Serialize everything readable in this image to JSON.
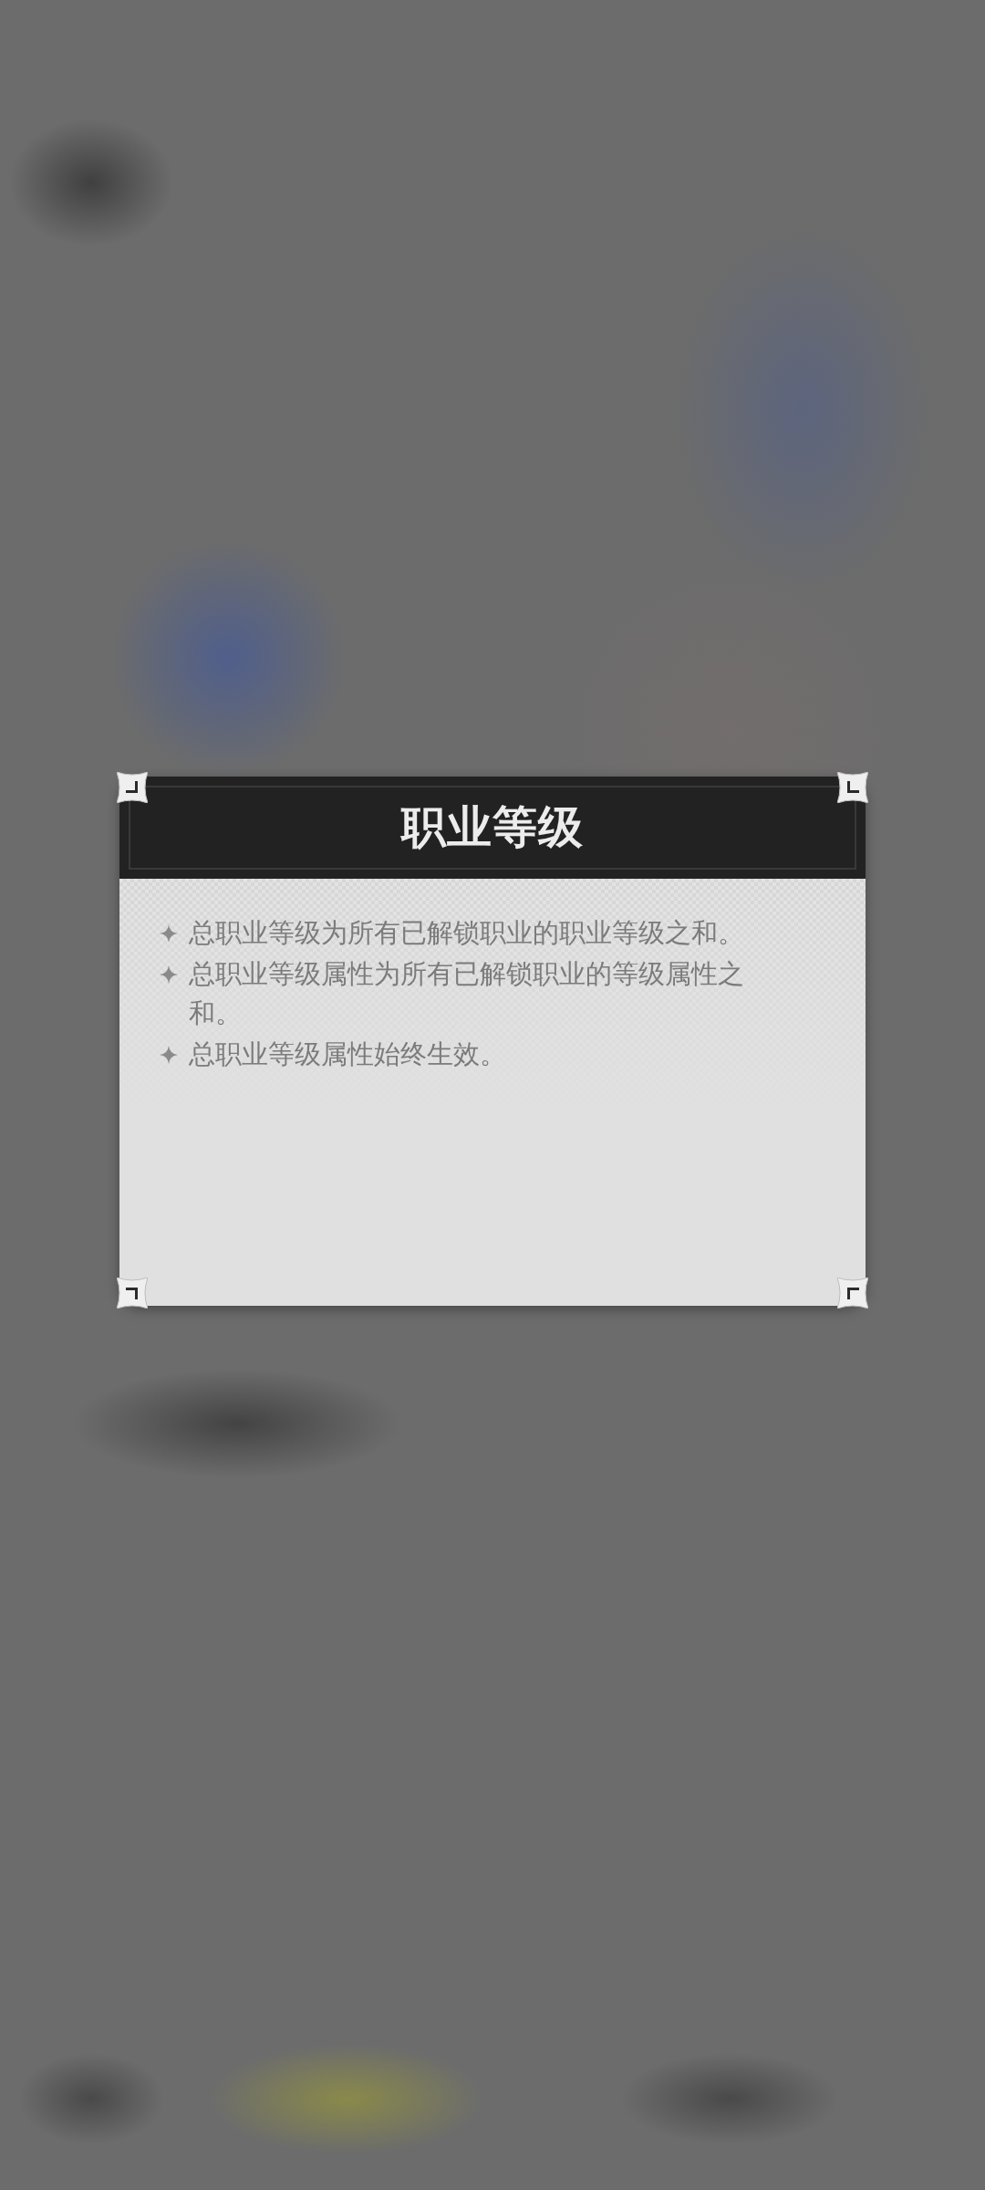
{
  "dialog": {
    "title": "职业等级",
    "tips": [
      "总职业等级为所有已解锁职业的职业等级之和。",
      "总职业等级属性为所有已解锁职业的等级属性之和。",
      "总职业等级属性始终生效。"
    ]
  }
}
